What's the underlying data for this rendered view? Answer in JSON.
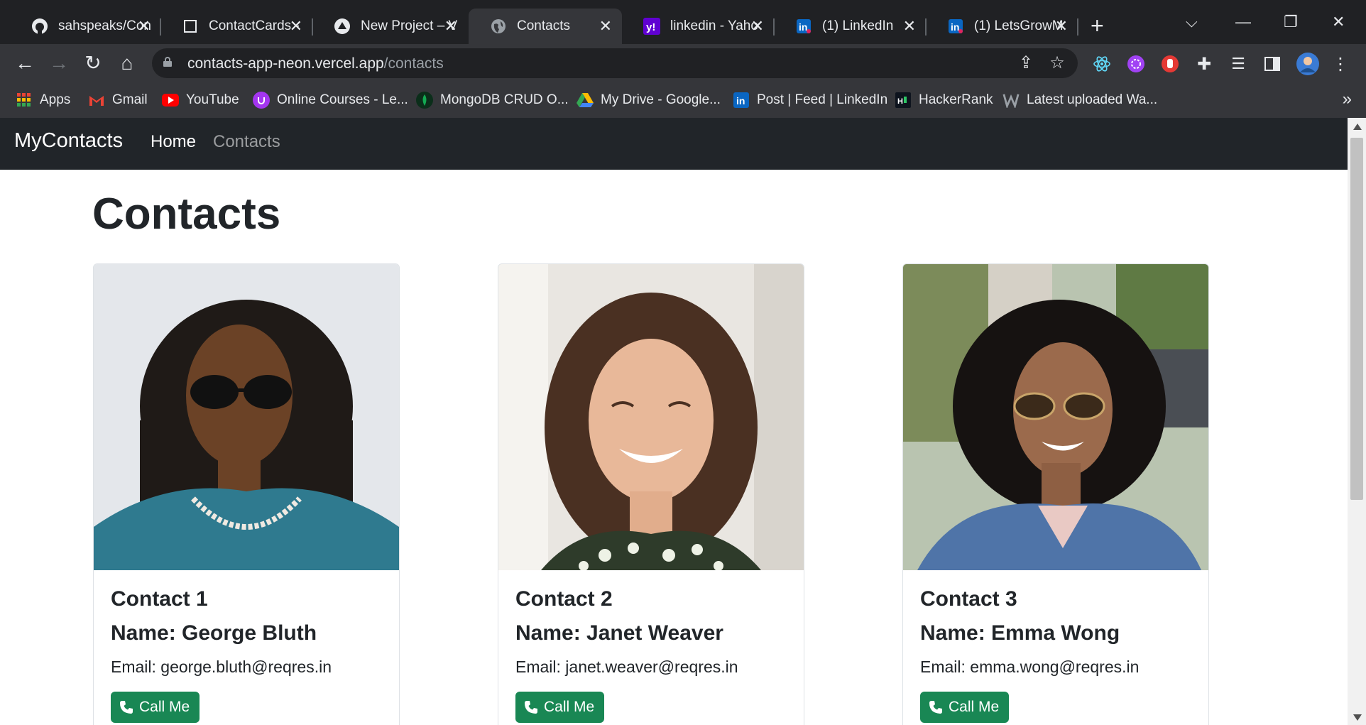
{
  "browser": {
    "tabs": [
      {
        "title": "sahspeaks/Con",
        "icon": "github-icon"
      },
      {
        "title": "ContactCards -",
        "icon": "page-icon"
      },
      {
        "title": "New Project – V",
        "icon": "vercel-icon"
      },
      {
        "title": "Contacts",
        "icon": "globe-icon",
        "active": true
      },
      {
        "title": "linkedin - Yaho",
        "icon": "yahoo-icon"
      },
      {
        "title": "(1) LinkedIn",
        "icon": "linkedin-icon"
      },
      {
        "title": "(1) LetsGrowM",
        "icon": "linkedin-icon"
      }
    ],
    "url": {
      "host": "contacts-app-neon.vercel.app",
      "path": "/contacts"
    },
    "bookmarks": [
      {
        "label": "Apps",
        "icon": "apps-grid-icon"
      },
      {
        "label": "Gmail",
        "icon": "gmail-icon"
      },
      {
        "label": "YouTube",
        "icon": "youtube-icon"
      },
      {
        "label": "Online Courses - Le...",
        "icon": "udemy-icon"
      },
      {
        "label": "MongoDB CRUD O...",
        "icon": "mongodb-icon"
      },
      {
        "label": "My Drive - Google...",
        "icon": "google-drive-icon"
      },
      {
        "label": "Post | Feed | LinkedIn",
        "icon": "linkedin-icon"
      },
      {
        "label": "HackerRank",
        "icon": "hackerrank-icon"
      },
      {
        "label": "Latest uploaded Wa...",
        "icon": "w-icon"
      }
    ]
  },
  "app": {
    "brand": "MyContacts",
    "nav": [
      {
        "label": "Home",
        "active": true
      },
      {
        "label": "Contacts",
        "active": false
      }
    ],
    "page_title": "Contacts",
    "contacts": [
      {
        "title": "Contact 1",
        "name": "Name: George Bluth",
        "email": "Email: george.bluth@reqres.in",
        "call_label": "Call Me"
      },
      {
        "title": "Contact 2",
        "name": "Name: Janet Weaver",
        "email": "Email: janet.weaver@reqres.in",
        "call_label": "Call Me"
      },
      {
        "title": "Contact 3",
        "name": "Name: Emma Wong",
        "email": "Email: emma.wong@reqres.in",
        "call_label": "Call Me"
      }
    ]
  },
  "colors": {
    "navbar_bg": "#212529",
    "call_button": "#198754",
    "browser_dark": "#202124",
    "browser_toolbar": "#35363a"
  }
}
